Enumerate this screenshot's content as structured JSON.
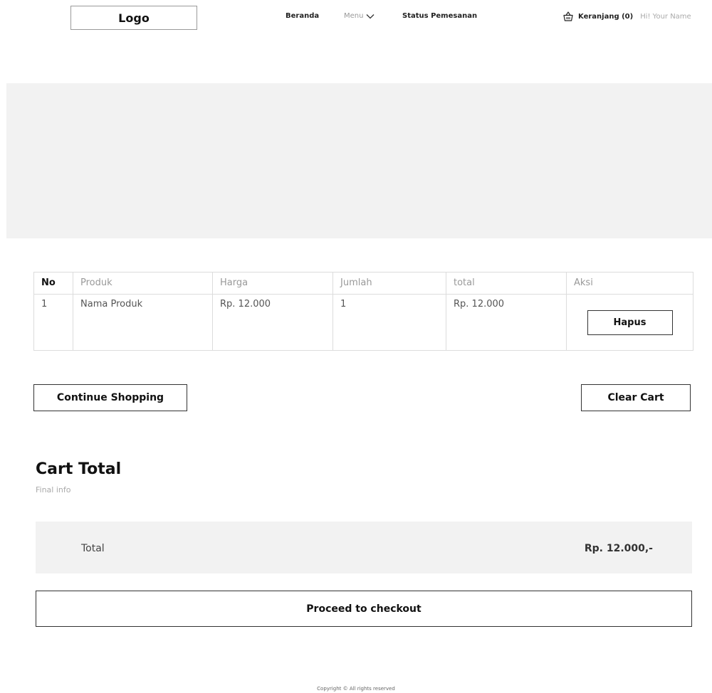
{
  "header": {
    "logo": "Logo",
    "nav": {
      "beranda": "Beranda",
      "menu": "Menu",
      "status": "Status Pemesanan"
    },
    "cart_label": "Keranjang (0)",
    "greeting": "Hi! Your Name"
  },
  "table": {
    "headers": [
      "No",
      "Produk",
      "Harga",
      "Jumlah",
      "total",
      "Aksi"
    ],
    "rows": [
      {
        "no": "1",
        "produk": "Nama Produk",
        "harga": "Rp. 12.000",
        "jumlah": "1",
        "total": "Rp. 12.000",
        "action_label": "Hapus"
      }
    ]
  },
  "buttons": {
    "continue": "Continue Shopping",
    "clear": "Clear Cart",
    "checkout": "Proceed  to checkout"
  },
  "cart_total": {
    "title": "Cart Total",
    "subtitle": "Final info",
    "label": "Total",
    "value": "Rp. 12.000,-"
  },
  "footer": {
    "copyright": "Copyright © All rights reserved"
  }
}
